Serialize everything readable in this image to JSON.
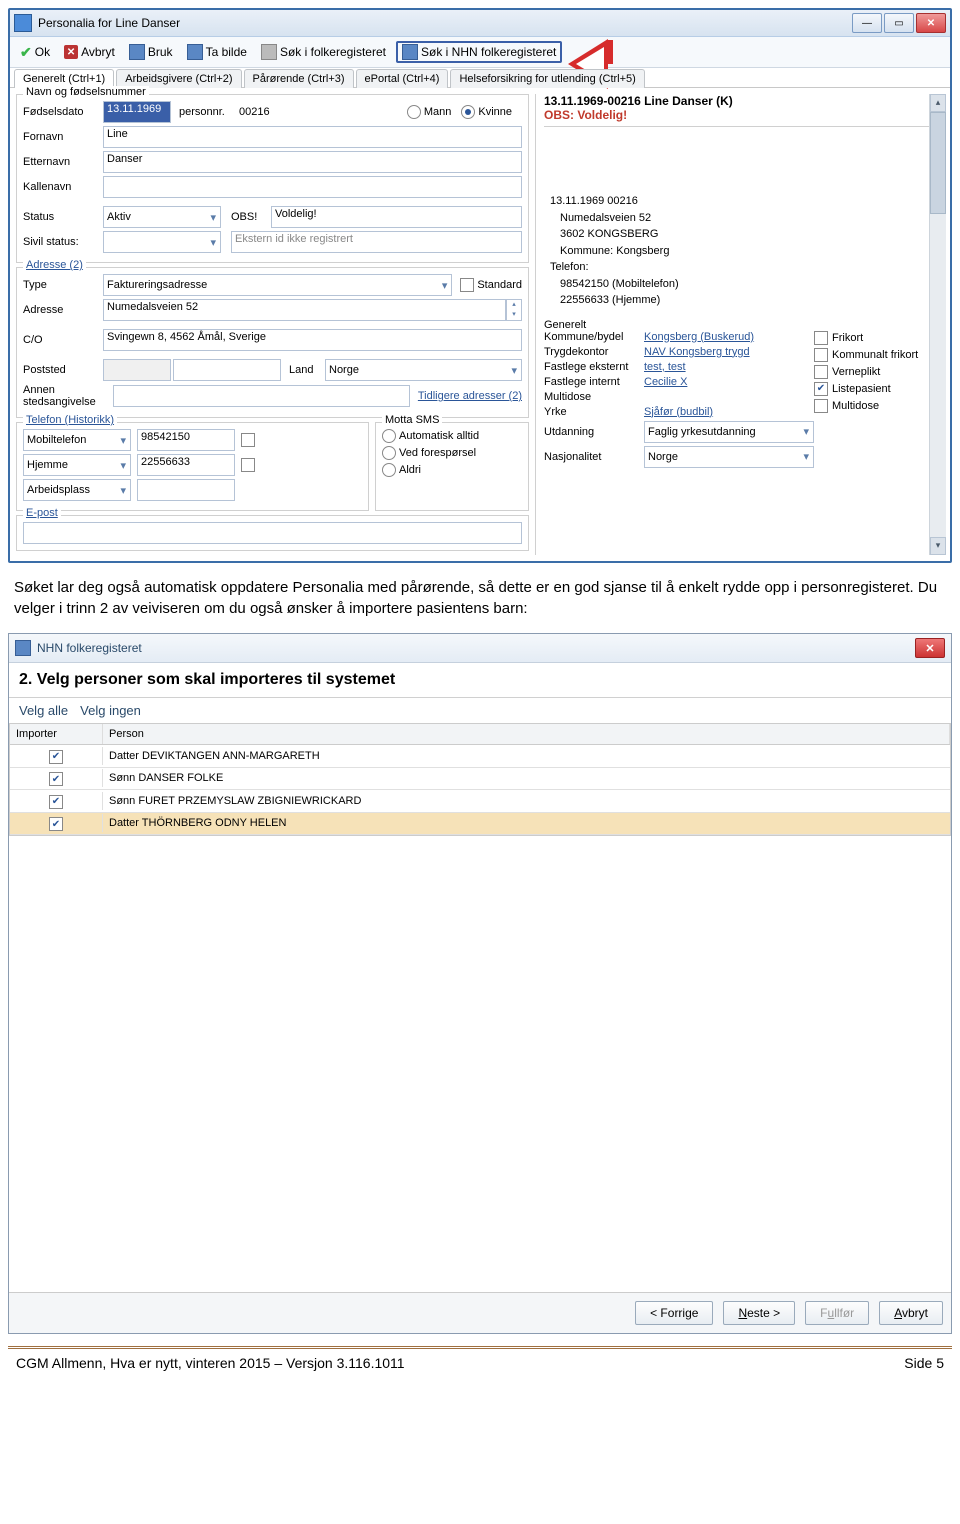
{
  "win1": {
    "title": "Personalia for Line Danser",
    "toolbar": {
      "ok": "Ok",
      "avbryt": "Avbryt",
      "bruk": "Bruk",
      "tabilde": "Ta bilde",
      "sok1": "Søk i folkeregisteret",
      "sok2": "Søk i NHN folkeregisteret"
    },
    "tabs": [
      "Generelt (Ctrl+1)",
      "Arbeidsgivere (Ctrl+2)",
      "Pårørende (Ctrl+3)",
      "ePortal (Ctrl+4)",
      "Helseforsikring for utlending (Ctrl+5)"
    ],
    "group1": {
      "legend": "Navn og fødselsnummer",
      "fodselsdato_lbl": "Fødselsdato",
      "fodselsdato": "13.11.1969",
      "personnr_lbl": "personnr.",
      "personnr": "00216",
      "fornavn_lbl": "Fornavn",
      "fornavn": "Line",
      "etternavn_lbl": "Etternavn",
      "etternavn": "Danser",
      "kallenavn_lbl": "Kallenavn",
      "mann": "Mann",
      "kvinne": "Kvinne",
      "status_lbl": "Status",
      "status": "Aktiv",
      "obs_lbl": "OBS!",
      "obs": "Voldelig!",
      "sivil_lbl": "Sivil status:",
      "eksternid": "Ekstern id ikke registrert"
    },
    "group2": {
      "legend": "Adresse (2)",
      "type_lbl": "Type",
      "type": "Faktureringsadresse",
      "standard": "Standard",
      "adresse_lbl": "Adresse",
      "adresse": "Numedalsveien 52",
      "co_lbl": "C/O",
      "co": "Svingewn 8, 4562 Åmål, Sverige",
      "poststed_lbl": "Poststed",
      "land_lbl": "Land",
      "land": "Norge",
      "annen_lbl": "Annen stedsangivelse",
      "tidligere": "Tidligere adresser (2)"
    },
    "telefon": {
      "legend": "Telefon (Historikk)",
      "mobil": "Mobiltelefon",
      "mobilnr": "98542150",
      "hjemme": "Hjemme",
      "hjemmenr": "22556633",
      "arbeid": "Arbeidsplass"
    },
    "sms": {
      "legend": "Motta SMS",
      "auto": "Automatisk alltid",
      "ved": "Ved forespørsel",
      "aldri": "Aldri"
    },
    "epost": "E-post",
    "right": {
      "hdr": "13.11.1969-00216 Line Danser (K)",
      "obs": "OBS: Voldelig!",
      "info1": "13.11.1969 00216",
      "info2": "Numedalsveien 52",
      "info3": "3602 KONGSBERG",
      "info4": "Kommune: Kongsberg",
      "info5": "Telefon:",
      "info6": "98542150 (Mobiltelefon)",
      "info7": "22556633 (Hjemme)",
      "gen": "Generelt",
      "kommune_lbl": "Kommune/bydel",
      "kommune": "Kongsberg (Buskerud)",
      "trygd_lbl": "Trygdekontor",
      "trygd": "NAV Kongsberg trygd",
      "fext_lbl": "Fastlege eksternt",
      "fext": "test, test",
      "fint_lbl": "Fastlege internt",
      "fint": "Cecilie X",
      "multi_lbl": "Multidose",
      "yrke_lbl": "Yrke",
      "yrke": "Sjåfør (budbil)",
      "utd_lbl": "Utdanning",
      "utd": "Faglig yrkesutdanning",
      "nasj_lbl": "Nasjonalitet",
      "nasj": "Norge",
      "cb1": "Frikort",
      "cb2": "Kommunalt frikort",
      "cb3": "Verneplikt",
      "cb4": "Listepasient",
      "cb5": "Multidose"
    }
  },
  "para1": "Søket lar deg også automatisk oppdatere Personalia med pårørende, så dette er en god sjanse til å enkelt rydde opp i personregisteret. Du velger i trinn 2 av veiviseren om du også ønsker å importere pasientens barn:",
  "win2": {
    "title": "NHN folkeregisteret",
    "step": "2. Velg personer som skal importeres til systemet",
    "velgalle": "Velg alle",
    "velgingen": "Velg ingen",
    "cols": {
      "c1": "Importer",
      "c2": "Person"
    },
    "rows": [
      {
        "c": true,
        "p": "Datter DEVIKTANGEN ANN-MARGARETH"
      },
      {
        "c": true,
        "p": "Sønn DANSER FOLKE"
      },
      {
        "c": true,
        "p": "Sønn FURET PRZEMYSLAW ZBIGNIEWRICKARD"
      },
      {
        "c": true,
        "p": "Datter THÖRNBERG ODNY HELEN"
      }
    ],
    "btns": {
      "forrige": "< Forrige",
      "neste": "Neste >",
      "fullfor": "Fullfør",
      "avbryt": "Avbryt"
    }
  },
  "footer": {
    "left": "CGM Allmenn, Hva er nytt, vinteren 2015 – Versjon 3.116.1011",
    "right": "Side 5"
  }
}
